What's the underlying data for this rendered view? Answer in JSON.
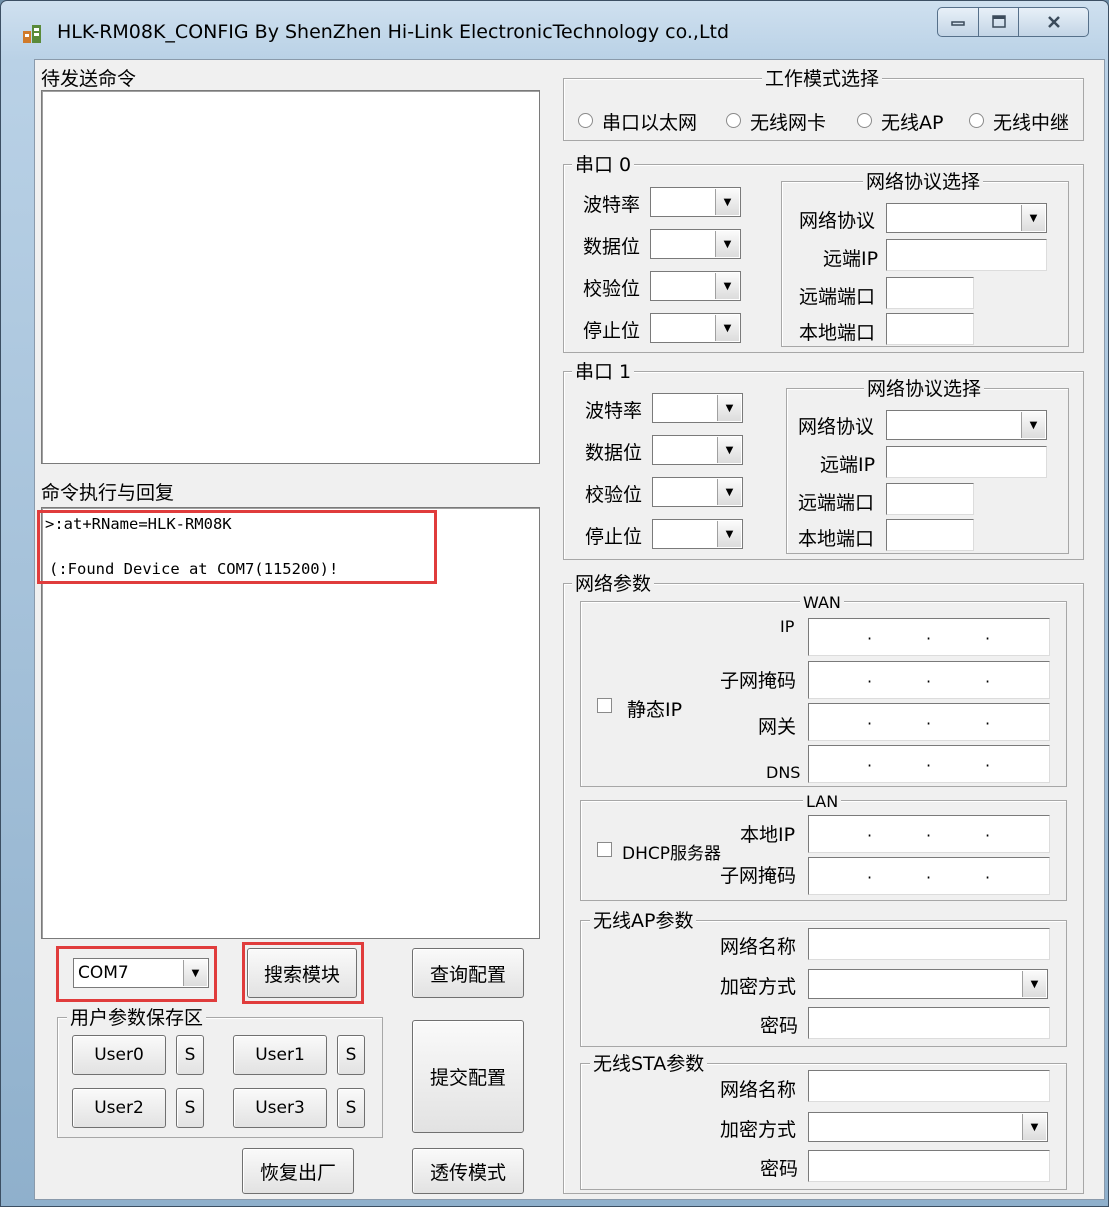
{
  "window": {
    "title": "HLK-RM08K_CONFIG By ShenZhen Hi-Link ElectronicTechnology co.,Ltd",
    "min_icon": "minimize-icon",
    "max_icon": "maximize-icon",
    "close_icon": "close-icon"
  },
  "left": {
    "pending_label": "待发送命令",
    "reply_label": "命令执行与回复",
    "reply_lines": [
      ">:at+RName=HLK-RM08K",
      "(:Found Device at COM7(115200)!"
    ],
    "port_value": "COM7",
    "search_btn": "搜索模块",
    "query_btn": "查询配置",
    "user_group_title": "用户参数保存区",
    "user0": "User0",
    "user1": "User1",
    "user2": "User2",
    "user3": "User3",
    "s": "S",
    "submit_btn": "提交配置",
    "restore_btn": "恢复出厂",
    "transparent_btn": "透传模式"
  },
  "mode": {
    "title": "工作模式选择",
    "options": [
      "串口以太网",
      "无线网卡",
      "无线AP",
      "无线中继"
    ]
  },
  "serial0": {
    "title": "串口 0",
    "baud": "波特率",
    "data_bits": "数据位",
    "parity": "校验位",
    "stop_bits": "停止位",
    "net_title": "网络协议选择",
    "protocol": "网络协议",
    "remote_ip": "远端IP",
    "remote_port": "远端端口",
    "local_port": "本地端口"
  },
  "serial1": {
    "title": "串口 1",
    "baud": "波特率",
    "data_bits": "数据位",
    "parity": "校验位",
    "stop_bits": "停止位",
    "net_title": "网络协议选择",
    "protocol": "网络协议",
    "remote_ip": "远端IP",
    "remote_port": "远端端口",
    "local_port": "本地端口"
  },
  "network": {
    "title": "网络参数",
    "wan_title": "WAN",
    "static_ip": "静态IP",
    "ip": "IP",
    "mask": "子网掩码",
    "gateway": "网关",
    "dns": "DNS",
    "lan_title": "LAN",
    "dhcp": "DHCP服务器",
    "local_ip": "本地IP",
    "lan_mask": "子网掩码",
    "ap_title": "无线AP参数",
    "ap_ssid": "网络名称",
    "ap_enc": "加密方式",
    "ap_pwd": "密码",
    "sta_title": "无线STA参数",
    "sta_ssid": "网络名称",
    "sta_enc": "加密方式",
    "sta_pwd": "密码"
  },
  "colors": {
    "highlight": "#e03c3c",
    "client_bg": "#f0f0f0"
  }
}
